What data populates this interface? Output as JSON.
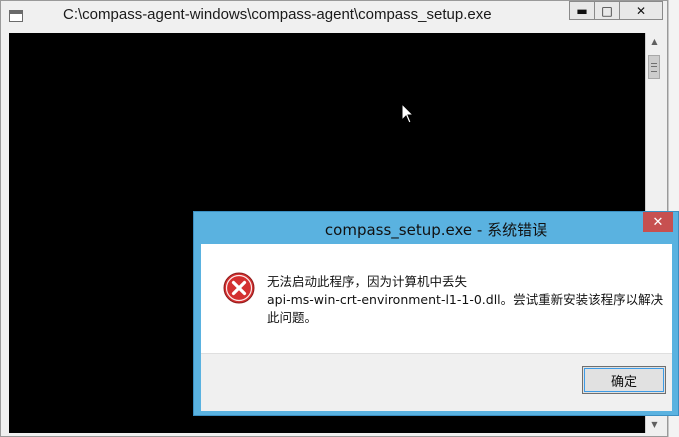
{
  "console": {
    "title": "C:\\compass-agent-windows\\compass-agent\\compass_setup.exe",
    "controls": {
      "minimize": "▬",
      "maximize": "□",
      "close": "✕"
    }
  },
  "dialog": {
    "title": "compass_setup.exe - 系统错误",
    "close": "✕",
    "message_lines": [
      "无法启动此程序，因为计算机中丢失",
      "api-ms-win-crt-environment-l1-1-0.dll。尝试重新安装该程序以解决",
      "此问题。"
    ],
    "ok_label": "确定",
    "icon": "error-icon",
    "colors": {
      "frame": "#5ab2e0",
      "close": "#c75050",
      "error": "#d32f2f"
    }
  }
}
